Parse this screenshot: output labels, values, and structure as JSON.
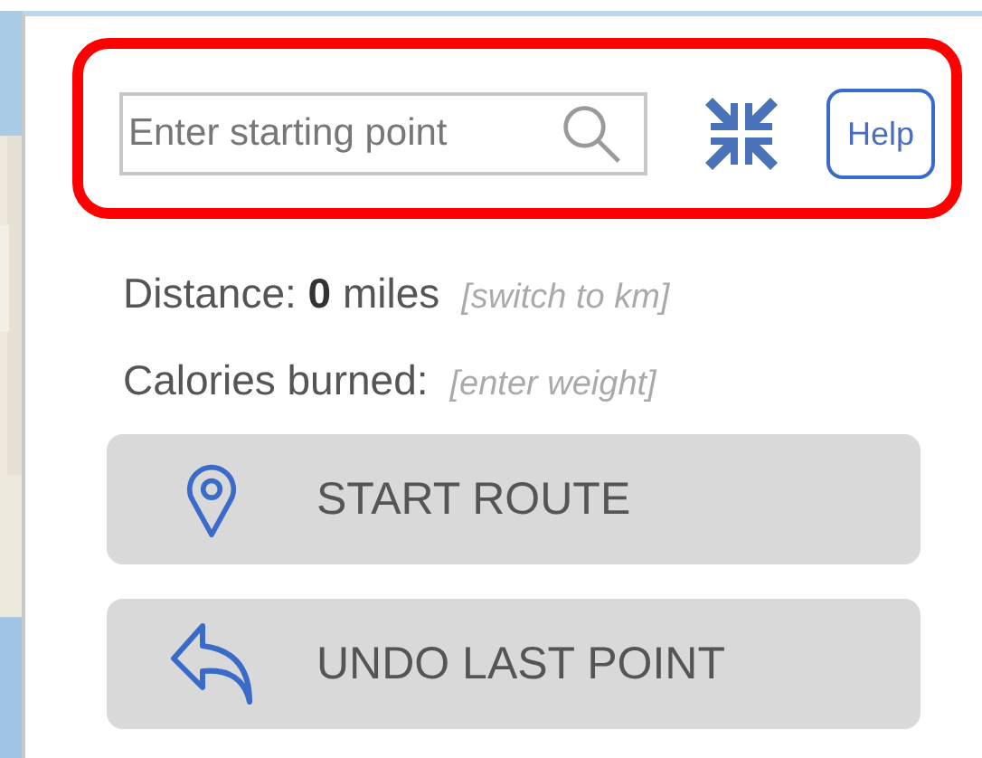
{
  "search": {
    "placeholder": "Enter starting point"
  },
  "help_button": "Help",
  "stats": [
    {
      "label": "Distance: **0** miles",
      "link": "[switch to km]"
    },
    {
      "label": "Calories burned:",
      "link": "[enter weight]"
    }
  ],
  "buttons": [
    {
      "kind": "pin",
      "label": "START ROUTE"
    },
    {
      "kind": "undo",
      "label": "UNDO LAST POINT"
    }
  ]
}
